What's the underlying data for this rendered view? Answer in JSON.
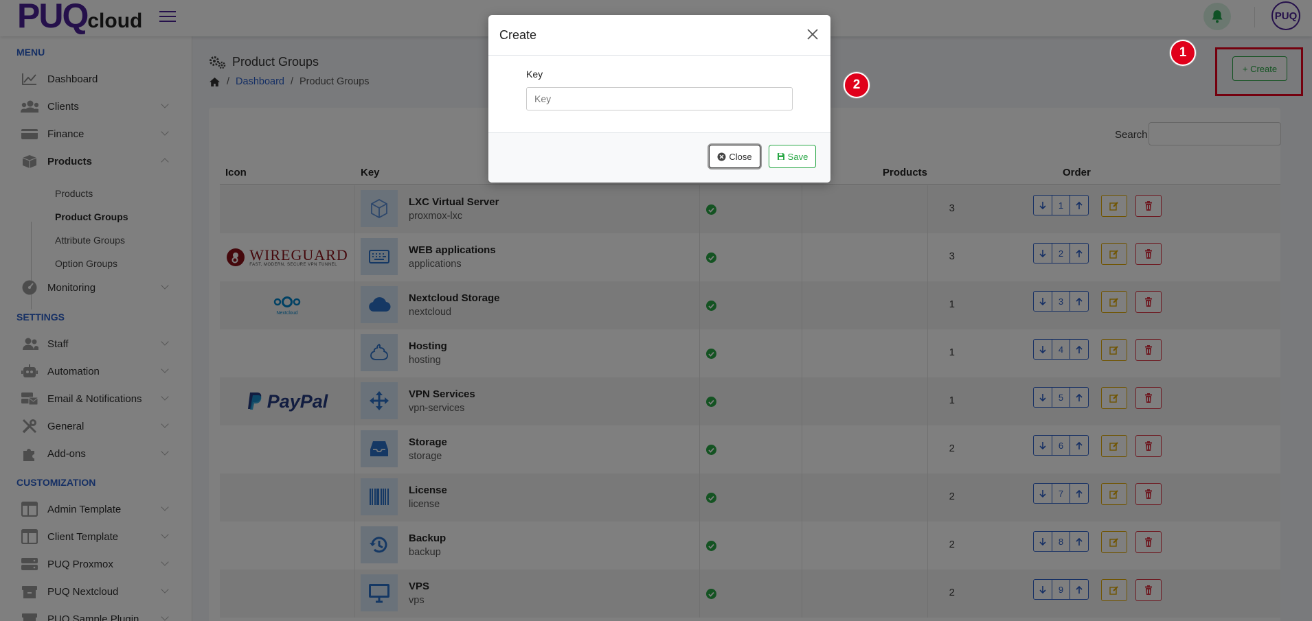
{
  "brand": {
    "logo_main": "PUQ",
    "logo_sub": "cloud"
  },
  "header": {
    "avatar_text": "PUQ"
  },
  "sidebar": {
    "sections": [
      "MENU",
      "SETTINGS",
      "CUSTOMIZATION"
    ],
    "menu": [
      {
        "label": "Dashboard"
      },
      {
        "label": "Clients"
      },
      {
        "label": "Finance"
      },
      {
        "label": "Products"
      },
      {
        "label": "Monitoring"
      }
    ],
    "products_sub": [
      "Products",
      "Product Groups",
      "Attribute Groups",
      "Option Groups"
    ],
    "settings": [
      {
        "label": "Staff"
      },
      {
        "label": "Automation"
      },
      {
        "label": "Email & Notifications"
      },
      {
        "label": "General"
      },
      {
        "label": "Add-ons"
      }
    ],
    "customization": [
      {
        "label": "Admin Template"
      },
      {
        "label": "Client Template"
      },
      {
        "label": "PUQ Proxmox"
      },
      {
        "label": "PUQ Nextcloud"
      },
      {
        "label": "PUQ Sample Plugin"
      }
    ]
  },
  "page": {
    "title": "Product Groups",
    "breadcrumb": [
      "Dashboard",
      "Product Groups"
    ],
    "create_label": "Create",
    "search_label": "Search"
  },
  "table": {
    "headers": {
      "icon": "Icon",
      "key": "Key",
      "products": "Products",
      "order": "Order"
    },
    "rows": [
      {
        "icon": "",
        "name": "LXC Virtual Server",
        "key": "proxmox-lxc",
        "products": "3",
        "order": "1"
      },
      {
        "icon": "WireGuard",
        "name": "WEB applications",
        "key": "applications",
        "products": "3",
        "order": "2"
      },
      {
        "icon": "Nextcloud",
        "name": "Nextcloud Storage",
        "key": "nextcloud",
        "products": "1",
        "order": "3"
      },
      {
        "icon": "",
        "name": "Hosting",
        "key": "hosting",
        "products": "1",
        "order": "4"
      },
      {
        "icon": "PayPal",
        "name": "VPN Services",
        "key": "vpn-services",
        "products": "1",
        "order": "5"
      },
      {
        "icon": "",
        "name": "Storage",
        "key": "storage",
        "products": "2",
        "order": "6"
      },
      {
        "icon": "",
        "name": "License",
        "key": "license",
        "products": "2",
        "order": "7"
      },
      {
        "icon": "",
        "name": "Backup",
        "key": "backup",
        "products": "2",
        "order": "8"
      },
      {
        "icon": "",
        "name": "VPS",
        "key": "vps",
        "products": "2",
        "order": "9"
      }
    ],
    "logo_texts": {
      "wireguard": "WIREGUARD",
      "wireguard_tag": "FAST, MODERN, SECURE VPN TUNNEL",
      "nextcloud": "Nextcloud",
      "paypal": "PayPal"
    }
  },
  "modal": {
    "title": "Create",
    "field_label": "Key",
    "field_placeholder": "Key",
    "field_value": "",
    "close_label": "Close",
    "save_label": "Save"
  },
  "markers": [
    "1",
    "2"
  ],
  "colors": {
    "brand": "#4b2096",
    "accent": "#2b5ec8",
    "success": "#28a745",
    "warning": "#e0a800",
    "danger": "#dc3545",
    "marker": "#e0001b"
  }
}
